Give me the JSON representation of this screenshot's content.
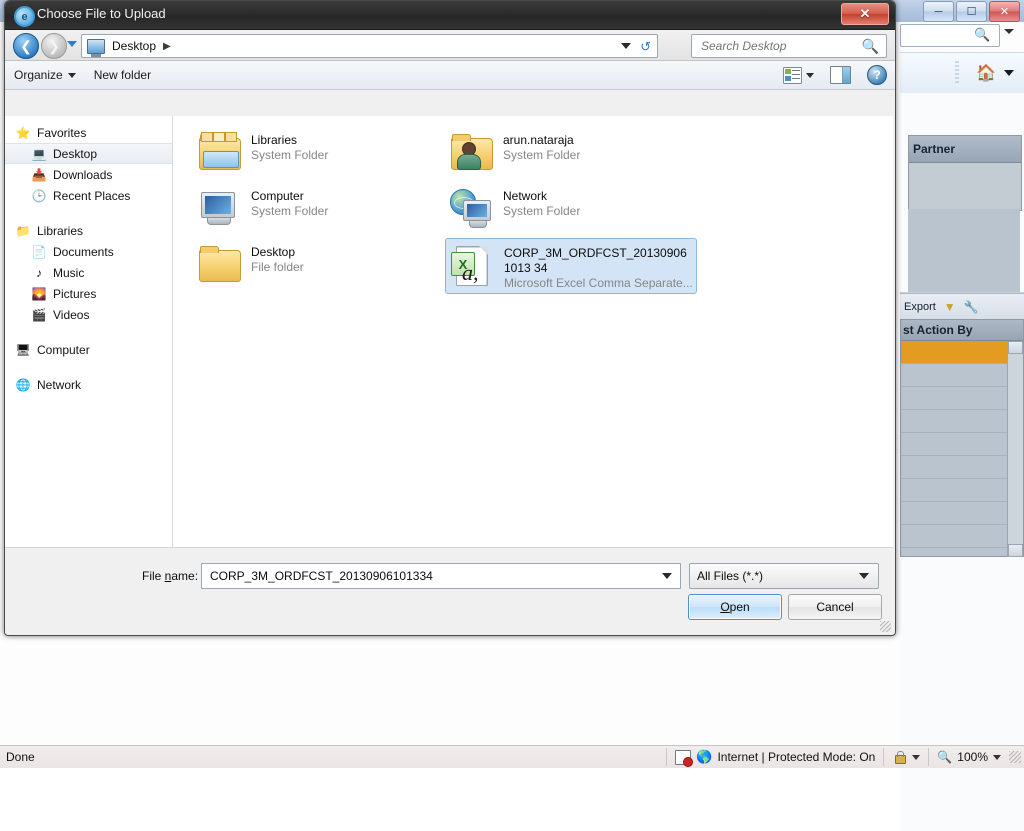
{
  "background_window": {
    "window_controls": [
      "minimize",
      "maximize",
      "close"
    ],
    "search_placeholder": "",
    "home_icon": "home-icon",
    "overflow_label": "»",
    "panel_header": "Partner",
    "toolbar": {
      "export_label": "Export",
      "filter_icon": "funnel-icon",
      "settings_icon": "wrench-icon"
    },
    "grid_header": "st Action By",
    "row_count": 10,
    "highlight_color": "#e49b21"
  },
  "status_bar": {
    "page_status": "Done",
    "blocked_icon": "blocked-content-icon",
    "zone_icon": "internet-zone-icon",
    "zone_text": "Internet | Protected Mode: On",
    "privacy_icon": "privacy-lock-icon",
    "zoom_icon": "zoom-magnifier-icon",
    "zoom_level": "100%"
  },
  "dialog": {
    "icon": "internet-explorer-icon",
    "title": "Choose File to Upload",
    "close_label": "✕",
    "nav": {
      "back_icon": "back-arrow-icon",
      "forward_icon": "forward-arrow-icon",
      "history_icon": "history-dropdown-icon",
      "breadcrumb_icon": "desktop-icon",
      "breadcrumb": "Desktop",
      "breadcrumb_separator": "▶",
      "refresh_icon": "refresh-icon",
      "search_placeholder": "Search Desktop",
      "search_value": "",
      "search_icon": "search-icon"
    },
    "toolbar": {
      "organize_label": "Organize",
      "new_folder_label": "New folder",
      "views_icon": "view-mode-icon",
      "preview_pane_icon": "preview-pane-icon",
      "help_icon": "help-icon"
    },
    "nav_pane": [
      {
        "label": "Favorites",
        "icon": "star-icon",
        "level": "root",
        "selected": false
      },
      {
        "label": "Desktop",
        "icon": "desktop-icon",
        "level": "child",
        "selected": true
      },
      {
        "label": "Downloads",
        "icon": "downloads-icon",
        "level": "child",
        "selected": false
      },
      {
        "label": "Recent Places",
        "icon": "recent-places-icon",
        "level": "child",
        "selected": false
      },
      {
        "label": "Libraries",
        "icon": "libraries-icon",
        "level": "root",
        "selected": false
      },
      {
        "label": "Documents",
        "icon": "document-icon",
        "level": "child",
        "selected": false
      },
      {
        "label": "Music",
        "icon": "music-note-icon",
        "level": "child",
        "selected": false
      },
      {
        "label": "Pictures",
        "icon": "picture-icon",
        "level": "child",
        "selected": false
      },
      {
        "label": "Videos",
        "icon": "video-icon",
        "level": "child",
        "selected": false
      },
      {
        "label": "Computer",
        "icon": "computer-icon",
        "level": "root",
        "selected": false
      },
      {
        "label": "Network",
        "icon": "network-icon",
        "level": "root",
        "selected": false
      }
    ],
    "files": [
      {
        "name": "Libraries",
        "type": "System Folder",
        "icon": "libraries-folder-icon",
        "selected": false
      },
      {
        "name": "arun.nataraja",
        "type": "System Folder",
        "icon": "user-folder-icon",
        "selected": false
      },
      {
        "name": "Computer",
        "type": "System Folder",
        "icon": "computer-icon",
        "selected": false
      },
      {
        "name": "Network",
        "type": "System Folder",
        "icon": "network-icon",
        "selected": false
      },
      {
        "name": "Desktop",
        "type": "File folder",
        "icon": "folder-icon",
        "selected": false
      },
      {
        "name": "CORP_3M_ORDFCST_201309061013 34",
        "type": "Microsoft Excel Comma Separate...",
        "icon": "csv-file-icon",
        "selected": true
      }
    ],
    "footer": {
      "file_name_label_pre": "File ",
      "file_name_label_key": "n",
      "file_name_label_post": "ame:",
      "file_name_value": "CORP_3M_ORDFCST_20130906101334",
      "file_type_value": "All Files (*.*)",
      "open_label_pre": "",
      "open_label_key": "O",
      "open_label_post": "pen",
      "cancel_label": "Cancel"
    }
  }
}
